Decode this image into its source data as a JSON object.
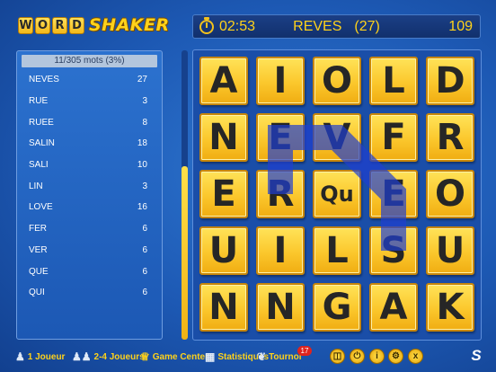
{
  "logo": {
    "tiles": [
      "W",
      "O",
      "R",
      "D"
    ],
    "text": "SHAKER"
  },
  "topbar": {
    "timer": "02:53",
    "word": "REVES",
    "word_count": "(27)",
    "score": "109"
  },
  "word_panel": {
    "header": "11/305 mots (3%)",
    "words": [
      {
        "word": "NEVES",
        "score": "27"
      },
      {
        "word": "RUE",
        "score": "3"
      },
      {
        "word": "RUEE",
        "score": "8"
      },
      {
        "word": "SALIN",
        "score": "18"
      },
      {
        "word": "SALI",
        "score": "10"
      },
      {
        "word": "LIN",
        "score": "3"
      },
      {
        "word": "LOVE",
        "score": "16"
      },
      {
        "word": "FER",
        "score": "6"
      },
      {
        "word": "VER",
        "score": "6"
      },
      {
        "word": "QUE",
        "score": "6"
      },
      {
        "word": "QUI",
        "score": "6"
      }
    ]
  },
  "progress": {
    "fraction": 0.6
  },
  "board": {
    "rows": [
      [
        "A",
        "I",
        "O",
        "L",
        "D"
      ],
      [
        "N",
        "E",
        "V",
        "F",
        "R"
      ],
      [
        "E",
        "R",
        "Qu",
        "E",
        "O"
      ],
      [
        "U",
        "I",
        "L",
        "S",
        "U"
      ],
      [
        "N",
        "N",
        "G",
        "A",
        "K"
      ]
    ],
    "path": [
      [
        2,
        1
      ],
      [
        1,
        1
      ],
      [
        1,
        2
      ],
      [
        2,
        3
      ],
      [
        3,
        3
      ]
    ],
    "path_color": "#1f3fd0"
  },
  "bottom": {
    "one_player": "1 Joueur",
    "multi_player": "2-4 Joueurs",
    "game_center": "Game Center",
    "stats": "Statistiques",
    "tournament": "Tournoi",
    "tournament_badge": "17",
    "info": "i",
    "close": "x",
    "s_logo": "S"
  },
  "colors": {
    "accent": "#ffd21a",
    "tile": "#fbc72c",
    "background": "#1d59b4"
  }
}
